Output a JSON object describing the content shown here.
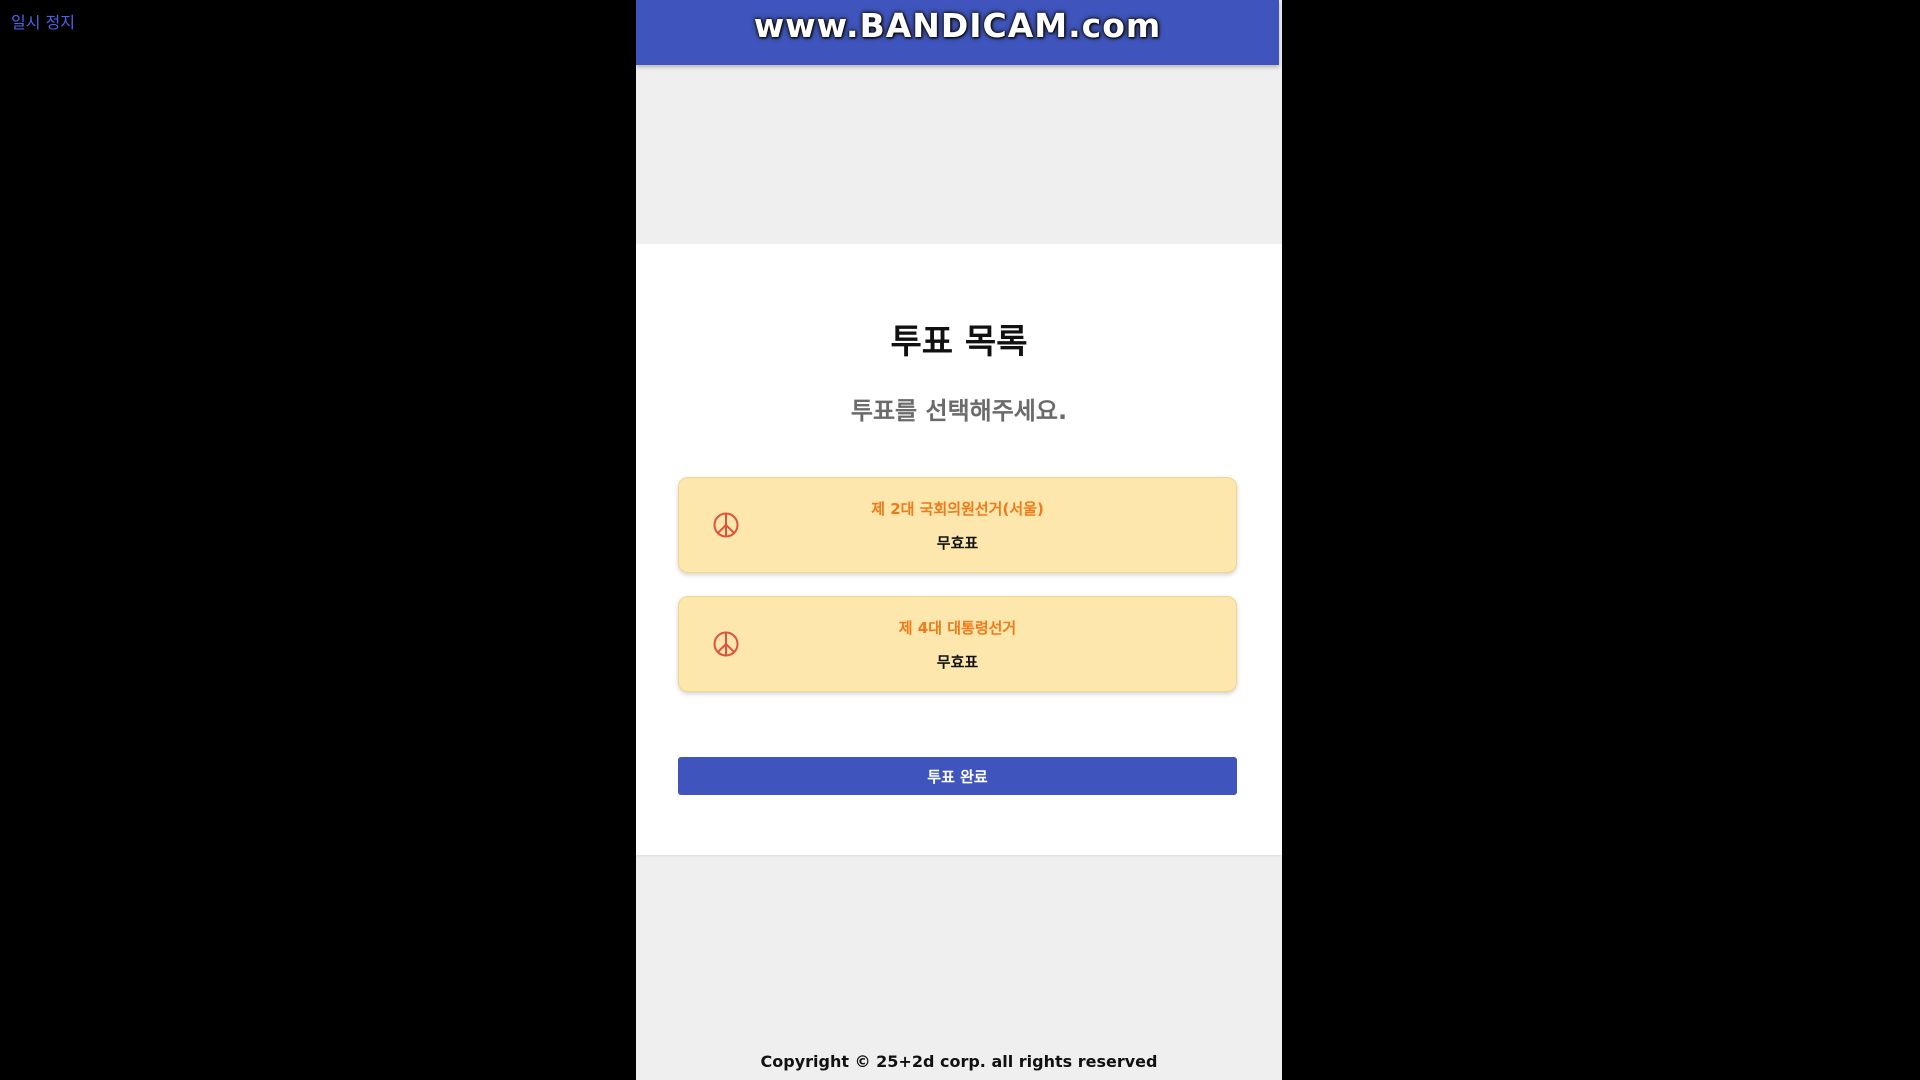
{
  "player": {
    "pause_label": "일시 정지"
  },
  "recorder": {
    "watermark": "www.BANDICAM.com"
  },
  "page": {
    "title": "투표 목록",
    "subtitle": "투표를 선택해주세요."
  },
  "votes": [
    {
      "name": "제 2대 국회의원선거(서울)",
      "status": "무효표",
      "icon": "peace-icon"
    },
    {
      "name": "제 4대 대통령선거",
      "status": "무효표",
      "icon": "peace-icon"
    }
  ],
  "actions": {
    "complete_label": "투표 완료"
  },
  "footer": {
    "copyright": "Copyright © 25+2d corp. all rights reserved"
  },
  "colors": {
    "primary": "#3f55bd",
    "card_bg": "#fde7ad",
    "accent_orange": "#f07a1a",
    "icon_red": "#e0533a",
    "page_bg": "#efefef",
    "pause_text": "#4a63e8"
  }
}
